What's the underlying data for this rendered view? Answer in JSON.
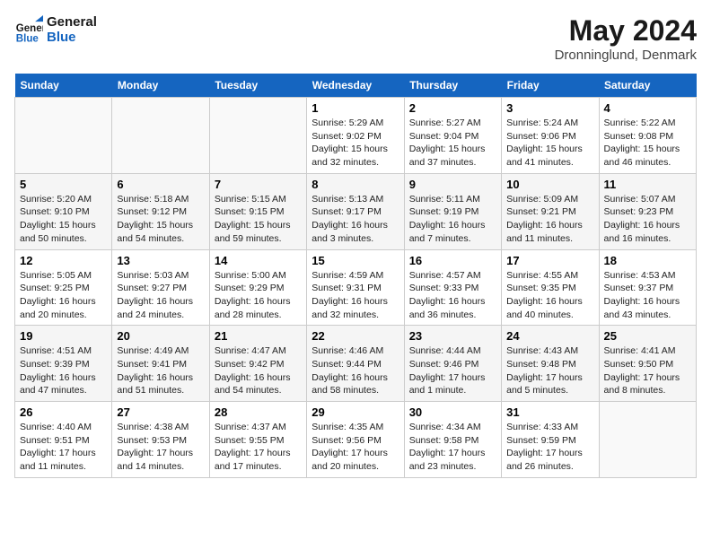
{
  "header": {
    "logo_line1": "General",
    "logo_line2": "Blue",
    "month": "May 2024",
    "location": "Dronninglund, Denmark"
  },
  "weekdays": [
    "Sunday",
    "Monday",
    "Tuesday",
    "Wednesday",
    "Thursday",
    "Friday",
    "Saturday"
  ],
  "weeks": [
    [
      {
        "day": "",
        "info": ""
      },
      {
        "day": "",
        "info": ""
      },
      {
        "day": "",
        "info": ""
      },
      {
        "day": "1",
        "info": "Sunrise: 5:29 AM\nSunset: 9:02 PM\nDaylight: 15 hours\nand 32 minutes."
      },
      {
        "day": "2",
        "info": "Sunrise: 5:27 AM\nSunset: 9:04 PM\nDaylight: 15 hours\nand 37 minutes."
      },
      {
        "day": "3",
        "info": "Sunrise: 5:24 AM\nSunset: 9:06 PM\nDaylight: 15 hours\nand 41 minutes."
      },
      {
        "day": "4",
        "info": "Sunrise: 5:22 AM\nSunset: 9:08 PM\nDaylight: 15 hours\nand 46 minutes."
      }
    ],
    [
      {
        "day": "5",
        "info": "Sunrise: 5:20 AM\nSunset: 9:10 PM\nDaylight: 15 hours\nand 50 minutes."
      },
      {
        "day": "6",
        "info": "Sunrise: 5:18 AM\nSunset: 9:12 PM\nDaylight: 15 hours\nand 54 minutes."
      },
      {
        "day": "7",
        "info": "Sunrise: 5:15 AM\nSunset: 9:15 PM\nDaylight: 15 hours\nand 59 minutes."
      },
      {
        "day": "8",
        "info": "Sunrise: 5:13 AM\nSunset: 9:17 PM\nDaylight: 16 hours\nand 3 minutes."
      },
      {
        "day": "9",
        "info": "Sunrise: 5:11 AM\nSunset: 9:19 PM\nDaylight: 16 hours\nand 7 minutes."
      },
      {
        "day": "10",
        "info": "Sunrise: 5:09 AM\nSunset: 9:21 PM\nDaylight: 16 hours\nand 11 minutes."
      },
      {
        "day": "11",
        "info": "Sunrise: 5:07 AM\nSunset: 9:23 PM\nDaylight: 16 hours\nand 16 minutes."
      }
    ],
    [
      {
        "day": "12",
        "info": "Sunrise: 5:05 AM\nSunset: 9:25 PM\nDaylight: 16 hours\nand 20 minutes."
      },
      {
        "day": "13",
        "info": "Sunrise: 5:03 AM\nSunset: 9:27 PM\nDaylight: 16 hours\nand 24 minutes."
      },
      {
        "day": "14",
        "info": "Sunrise: 5:00 AM\nSunset: 9:29 PM\nDaylight: 16 hours\nand 28 minutes."
      },
      {
        "day": "15",
        "info": "Sunrise: 4:59 AM\nSunset: 9:31 PM\nDaylight: 16 hours\nand 32 minutes."
      },
      {
        "day": "16",
        "info": "Sunrise: 4:57 AM\nSunset: 9:33 PM\nDaylight: 16 hours\nand 36 minutes."
      },
      {
        "day": "17",
        "info": "Sunrise: 4:55 AM\nSunset: 9:35 PM\nDaylight: 16 hours\nand 40 minutes."
      },
      {
        "day": "18",
        "info": "Sunrise: 4:53 AM\nSunset: 9:37 PM\nDaylight: 16 hours\nand 43 minutes."
      }
    ],
    [
      {
        "day": "19",
        "info": "Sunrise: 4:51 AM\nSunset: 9:39 PM\nDaylight: 16 hours\nand 47 minutes."
      },
      {
        "day": "20",
        "info": "Sunrise: 4:49 AM\nSunset: 9:41 PM\nDaylight: 16 hours\nand 51 minutes."
      },
      {
        "day": "21",
        "info": "Sunrise: 4:47 AM\nSunset: 9:42 PM\nDaylight: 16 hours\nand 54 minutes."
      },
      {
        "day": "22",
        "info": "Sunrise: 4:46 AM\nSunset: 9:44 PM\nDaylight: 16 hours\nand 58 minutes."
      },
      {
        "day": "23",
        "info": "Sunrise: 4:44 AM\nSunset: 9:46 PM\nDaylight: 17 hours\nand 1 minute."
      },
      {
        "day": "24",
        "info": "Sunrise: 4:43 AM\nSunset: 9:48 PM\nDaylight: 17 hours\nand 5 minutes."
      },
      {
        "day": "25",
        "info": "Sunrise: 4:41 AM\nSunset: 9:50 PM\nDaylight: 17 hours\nand 8 minutes."
      }
    ],
    [
      {
        "day": "26",
        "info": "Sunrise: 4:40 AM\nSunset: 9:51 PM\nDaylight: 17 hours\nand 11 minutes."
      },
      {
        "day": "27",
        "info": "Sunrise: 4:38 AM\nSunset: 9:53 PM\nDaylight: 17 hours\nand 14 minutes."
      },
      {
        "day": "28",
        "info": "Sunrise: 4:37 AM\nSunset: 9:55 PM\nDaylight: 17 hours\nand 17 minutes."
      },
      {
        "day": "29",
        "info": "Sunrise: 4:35 AM\nSunset: 9:56 PM\nDaylight: 17 hours\nand 20 minutes."
      },
      {
        "day": "30",
        "info": "Sunrise: 4:34 AM\nSunset: 9:58 PM\nDaylight: 17 hours\nand 23 minutes."
      },
      {
        "day": "31",
        "info": "Sunrise: 4:33 AM\nSunset: 9:59 PM\nDaylight: 17 hours\nand 26 minutes."
      },
      {
        "day": "",
        "info": ""
      }
    ]
  ]
}
